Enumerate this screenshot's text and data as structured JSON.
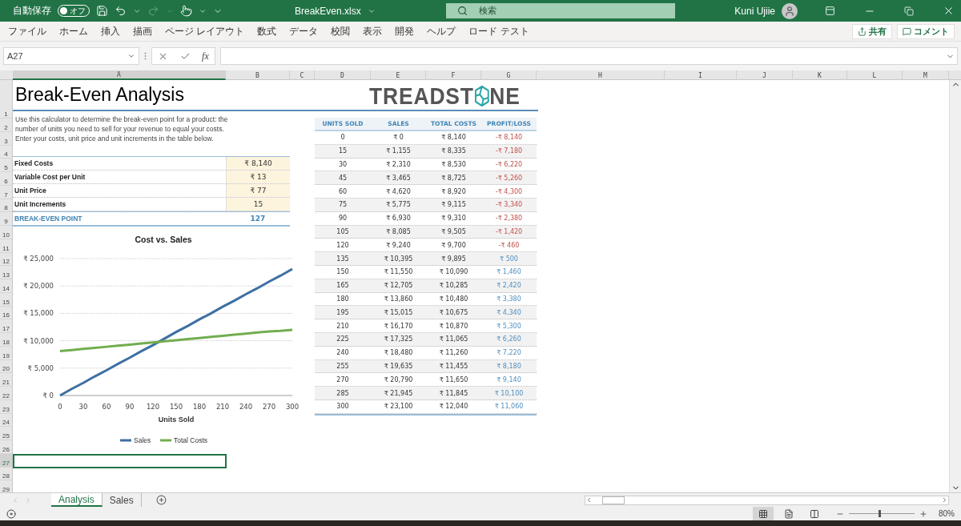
{
  "title_bar": {
    "autosave_label": "自動保存",
    "autosave": {
      "label": "オフ",
      "on": false
    },
    "file_name": "BreakEven.xlsx",
    "search": {
      "placeholder": "検索"
    },
    "user_name": "Kuni Ujiie"
  },
  "ribbon_tabs": [
    "ファイル",
    "ホーム",
    "挿入",
    "描画",
    "ページ レイアウト",
    "数式",
    "データ",
    "校閲",
    "表示",
    "開発",
    "ヘルプ",
    "ロード テスト"
  ],
  "share_button": "共有",
  "comment_button": "コメント",
  "formula_bar": {
    "name_box": "A27",
    "function_label": "fx"
  },
  "column_headers": [
    {
      "label": "A",
      "selected": true
    },
    {
      "label": "B",
      "selected": false
    },
    {
      "label": "C",
      "selected": false
    },
    {
      "label": "D",
      "selected": false
    },
    {
      "label": "E",
      "selected": false
    },
    {
      "label": "F",
      "selected": false
    },
    {
      "label": "G",
      "selected": false
    },
    {
      "label": "H",
      "selected": false
    },
    {
      "label": "I",
      "selected": false
    },
    {
      "label": "J",
      "selected": false
    },
    {
      "label": "K",
      "selected": false
    },
    {
      "label": "L",
      "selected": false
    },
    {
      "label": "M",
      "selected": false
    }
  ],
  "row_headers": [
    {
      "label": "1",
      "selected": false
    },
    {
      "label": "2",
      "selected": false
    },
    {
      "label": "3",
      "selected": false
    },
    {
      "label": "4",
      "selected": false
    },
    {
      "label": "5",
      "selected": false
    },
    {
      "label": "6",
      "selected": false
    },
    {
      "label": "7",
      "selected": false
    },
    {
      "label": "8",
      "selected": false
    },
    {
      "label": "9",
      "selected": false
    },
    {
      "label": "10",
      "selected": false
    },
    {
      "label": "11",
      "selected": false
    },
    {
      "label": "12",
      "selected": false
    },
    {
      "label": "13",
      "selected": false
    },
    {
      "label": "14",
      "selected": false
    },
    {
      "label": "15",
      "selected": false
    },
    {
      "label": "16",
      "selected": false
    },
    {
      "label": "17",
      "selected": false
    },
    {
      "label": "18",
      "selected": false
    },
    {
      "label": "19",
      "selected": false
    },
    {
      "label": "20",
      "selected": false
    },
    {
      "label": "21",
      "selected": false
    },
    {
      "label": "22",
      "selected": false
    },
    {
      "label": "23",
      "selected": false
    },
    {
      "label": "24",
      "selected": false
    },
    {
      "label": "25",
      "selected": false
    },
    {
      "label": "26",
      "selected": false
    },
    {
      "label": "27",
      "selected": true
    },
    {
      "label": "28",
      "selected": false
    },
    {
      "label": "29",
      "selected": false
    }
  ],
  "sheet": {
    "title": "Break-Even Analysis",
    "description": [
      "Use this calculator to determine the break-even point for a product: the",
      "number of units you need to sell for your revenue to equal your costs.",
      "Enter your costs, unit price and unit increments in the table below."
    ],
    "inputs": [
      {
        "label": "Fixed Costs",
        "value": "₹ 8,140"
      },
      {
        "label": "Variable Cost per Unit",
        "value": "₹ 13"
      },
      {
        "label": "Unit Price",
        "value": "₹ 77"
      },
      {
        "label": "Unit Increments",
        "value": "15"
      }
    ],
    "result": {
      "label": "BREAK-EVEN POINT",
      "value": "127"
    },
    "logo": {
      "before": "TREADST",
      "after": "NE"
    },
    "chart": {
      "chart_data": {
        "type": "line",
        "title": "Cost vs. Sales",
        "xlabel": "Units Sold",
        "x": [
          0,
          15,
          30,
          45,
          60,
          75,
          90,
          105,
          120,
          135,
          150,
          165,
          180,
          195,
          210,
          225,
          240,
          255,
          270,
          285,
          300
        ],
        "series": [
          {
            "name": "Sales",
            "color": "#3d6fa3",
            "values": [
              0,
              1200,
              2300,
              3500,
              4600,
              5800,
              6900,
              8100,
              9200,
              10400,
              11600,
              12700,
              13900,
              15000,
              16200,
              17300,
              18500,
              19600,
              20800,
              21900,
              23100
            ]
          },
          {
            "name": "Total Costs",
            "color": "#72ad4f",
            "values": [
              8100,
              8300,
              8500,
              8700,
              8900,
              9100,
              9300,
              9500,
              9700,
              9900,
              10100,
              10300,
              10500,
              10700,
              10900,
              11100,
              11300,
              11500,
              11700,
              11800,
              12000
            ]
          }
        ],
        "grid": true,
        "legend": true,
        "xlim": [
          0,
          300
        ],
        "ylim": [
          0,
          25000
        ],
        "xticks": [
          0,
          30,
          60,
          90,
          120,
          150,
          180,
          210,
          240,
          270,
          300
        ],
        "yticks": [
          {
            "value": 0,
            "label": "₹ 0"
          },
          {
            "value": 5000,
            "label": "₹ 5,000"
          },
          {
            "value": 10000,
            "label": "₹ 10,000"
          },
          {
            "value": 15000,
            "label": "₹ 15,000"
          },
          {
            "value": 20000,
            "label": "₹ 20,000"
          },
          {
            "value": 25000,
            "label": "₹ 25,000"
          }
        ]
      }
    },
    "table": {
      "columns": [
        "UNITS SOLD",
        "SALES",
        "TOTAL COSTS",
        "PROFIT/LOSS"
      ],
      "rows": [
        {
          "units": "0",
          "sales": "₹ 0",
          "total_costs": "₹ 8,140",
          "profit_loss": "-₹ 8,140",
          "kind": "loss"
        },
        {
          "units": "15",
          "sales": "₹ 1,155",
          "total_costs": "₹ 8,335",
          "profit_loss": "-₹ 7,180",
          "kind": "loss"
        },
        {
          "units": "30",
          "sales": "₹ 2,310",
          "total_costs": "₹ 8,530",
          "profit_loss": "-₹ 6,220",
          "kind": "loss"
        },
        {
          "units": "45",
          "sales": "₹ 3,465",
          "total_costs": "₹ 8,725",
          "profit_loss": "-₹ 5,260",
          "kind": "loss"
        },
        {
          "units": "60",
          "sales": "₹ 4,620",
          "total_costs": "₹ 8,920",
          "profit_loss": "-₹ 4,300",
          "kind": "loss"
        },
        {
          "units": "75",
          "sales": "₹ 5,775",
          "total_costs": "₹ 9,115",
          "profit_loss": "-₹ 3,340",
          "kind": "loss"
        },
        {
          "units": "90",
          "sales": "₹ 6,930",
          "total_costs": "₹ 9,310",
          "profit_loss": "-₹ 2,380",
          "kind": "loss"
        },
        {
          "units": "105",
          "sales": "₹ 8,085",
          "total_costs": "₹ 9,505",
          "profit_loss": "-₹ 1,420",
          "kind": "loss"
        },
        {
          "units": "120",
          "sales": "₹ 9,240",
          "total_costs": "₹ 9,700",
          "profit_loss": "-₹ 460",
          "kind": "loss"
        },
        {
          "units": "135",
          "sales": "₹ 10,395",
          "total_costs": "₹ 9,895",
          "profit_loss": "₹ 500",
          "kind": "profit"
        },
        {
          "units": "150",
          "sales": "₹ 11,550",
          "total_costs": "₹ 10,090",
          "profit_loss": "₹ 1,460",
          "kind": "profit"
        },
        {
          "units": "165",
          "sales": "₹ 12,705",
          "total_costs": "₹ 10,285",
          "profit_loss": "₹ 2,420",
          "kind": "profit"
        },
        {
          "units": "180",
          "sales": "₹ 13,860",
          "total_costs": "₹ 10,480",
          "profit_loss": "₹ 3,380",
          "kind": "profit"
        },
        {
          "units": "195",
          "sales": "₹ 15,015",
          "total_costs": "₹ 10,675",
          "profit_loss": "₹ 4,340",
          "kind": "profit"
        },
        {
          "units": "210",
          "sales": "₹ 16,170",
          "total_costs": "₹ 10,870",
          "profit_loss": "₹ 5,300",
          "kind": "profit"
        },
        {
          "units": "225",
          "sales": "₹ 17,325",
          "total_costs": "₹ 11,065",
          "profit_loss": "₹ 6,260",
          "kind": "profit"
        },
        {
          "units": "240",
          "sales": "₹ 18,480",
          "total_costs": "₹ 11,260",
          "profit_loss": "₹ 7,220",
          "kind": "profit"
        },
        {
          "units": "255",
          "sales": "₹ 19,635",
          "total_costs": "₹ 11,455",
          "profit_loss": "₹ 8,180",
          "kind": "profit"
        },
        {
          "units": "270",
          "sales": "₹ 20,790",
          "total_costs": "₹ 11,650",
          "profit_loss": "₹ 9,140",
          "kind": "profit"
        },
        {
          "units": "285",
          "sales": "₹ 21,945",
          "total_costs": "₹ 11,845",
          "profit_loss": "₹ 10,100",
          "kind": "profit"
        },
        {
          "units": "300",
          "sales": "₹ 23,100",
          "total_costs": "₹ 12,040",
          "profit_loss": "₹ 11,060",
          "kind": "profit"
        }
      ]
    }
  },
  "sheet_tabs": [
    {
      "label": "Analysis",
      "selected": true
    },
    {
      "label": "Sales",
      "selected": false
    }
  ],
  "status_bar": {
    "view_buttons": [
      {
        "kind": "normal",
        "selected": true
      },
      {
        "kind": "page_layout",
        "selected": false
      },
      {
        "kind": "page_break",
        "selected": false
      }
    ],
    "zoom_slider": {
      "level": 0.45
    },
    "zoom_label": "80%"
  }
}
